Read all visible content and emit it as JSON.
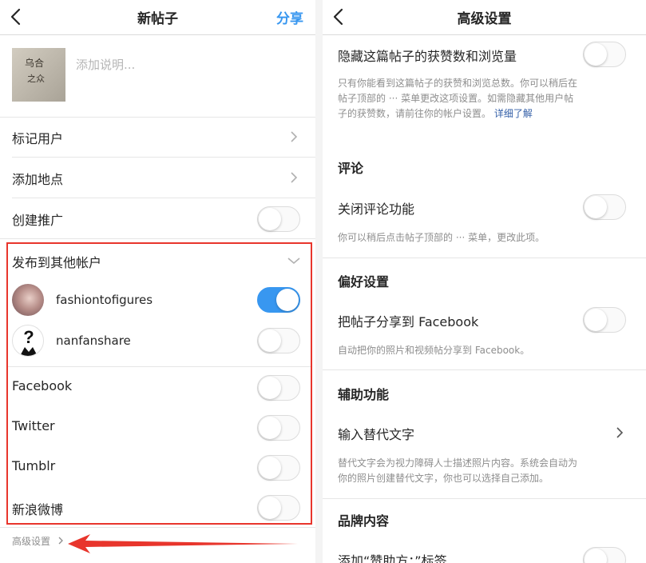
{
  "left": {
    "header": {
      "title": "新帖子",
      "action": "分享"
    },
    "thumbnail": {
      "line1": "乌合",
      "line2": "之众"
    },
    "caption_placeholder": "添加说明...",
    "rows": {
      "tag_people": "标记用户",
      "add_location": "添加地点",
      "create_promotion": "创建推广"
    },
    "post_to_other": {
      "label": "发布到其他帐户",
      "accounts": [
        {
          "name": "fashiontofigures",
          "enabled": true
        },
        {
          "name": "nanfanshare",
          "enabled": false
        }
      ],
      "services": [
        {
          "name": "Facebook",
          "enabled": false
        },
        {
          "name": "Twitter",
          "enabled": false
        },
        {
          "name": "Tumblr",
          "enabled": false
        },
        {
          "name": "新浪微博",
          "enabled": false
        }
      ]
    },
    "footer_link": "高级设置",
    "colors": {
      "accent": "#3897f0",
      "highlight": "#e8352c"
    }
  },
  "right": {
    "header": {
      "title": "高级设置"
    },
    "hide_likes": {
      "title": "隐藏这篇帖子的获赞数和浏览量",
      "desc_line1": "只有你能看到这篇帖子的获赞和浏览总数。你可以稍后在",
      "desc_line2": "帖子顶部的 ··· 菜单更改这项设置。如需隐藏其他用户帖",
      "desc_line3": "子的获赞数，请前往你的帐户设置。",
      "learn_more": "详细了解"
    },
    "comments": {
      "section": "评论",
      "title": "关闭评论功能",
      "desc": "你可以稍后点击帖子顶部的 ··· 菜单，更改此项。"
    },
    "preferences": {
      "section": "偏好设置",
      "title": "把帖子分享到 Facebook",
      "desc": "自动把你的照片和视频帖分享到 Facebook。"
    },
    "accessibility": {
      "section": "辅助功能",
      "title": "输入替代文字",
      "desc_line1": "替代文字会为视力障碍人士描述照片内容。系统会自动为",
      "desc_line2": "你的照片创建替代文字，你也可以选择自己添加。"
    },
    "branded": {
      "section": "品牌内容",
      "title": "添加“赞助方：”标签"
    }
  }
}
